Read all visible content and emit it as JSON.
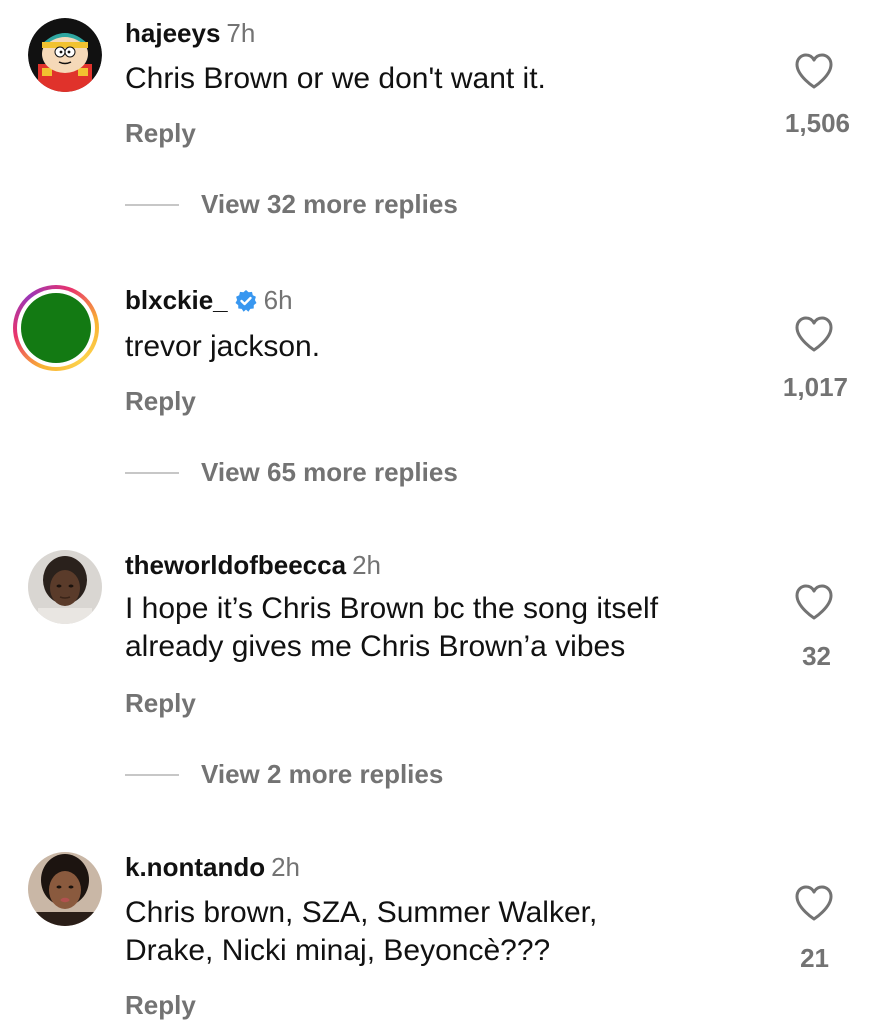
{
  "comments": [
    {
      "username": "hajeeys",
      "time": "7h",
      "text": "Chris Brown or we don't want it.",
      "reply_label": "Reply",
      "likes": "1,506",
      "view_replies": "View 32 more replies",
      "avatar": "cartman-cartoon-avatar"
    },
    {
      "username": "blxckie_",
      "time": "6h",
      "text": "trevor jackson.",
      "reply_label": "Reply",
      "likes": "1,017",
      "view_replies": "View 65 more replies",
      "verified": true,
      "avatar": "green-story-ring-avatar"
    },
    {
      "username": "theworldofbeecca",
      "time": "2h",
      "text_line1": "I hope it’s Chris Brown bc the song itself",
      "text_line2": "already gives me Chris Brown’a vibes",
      "reply_label": "Reply",
      "likes": "32",
      "view_replies": "View 2 more replies",
      "avatar": "user-photo-avatar"
    },
    {
      "username": "k.nontando",
      "time": "2h",
      "text_line1": "Chris brown, SZA, Summer Walker,",
      "text_line2": "Drake, Nicki minaj, Beyoncè???",
      "reply_label": "Reply",
      "likes": "21",
      "avatar": "user-photo-avatar"
    }
  ],
  "colors": {
    "secondary_text": "#737373",
    "verified_blue": "#3897f0",
    "divider": "#c7c7c7"
  }
}
